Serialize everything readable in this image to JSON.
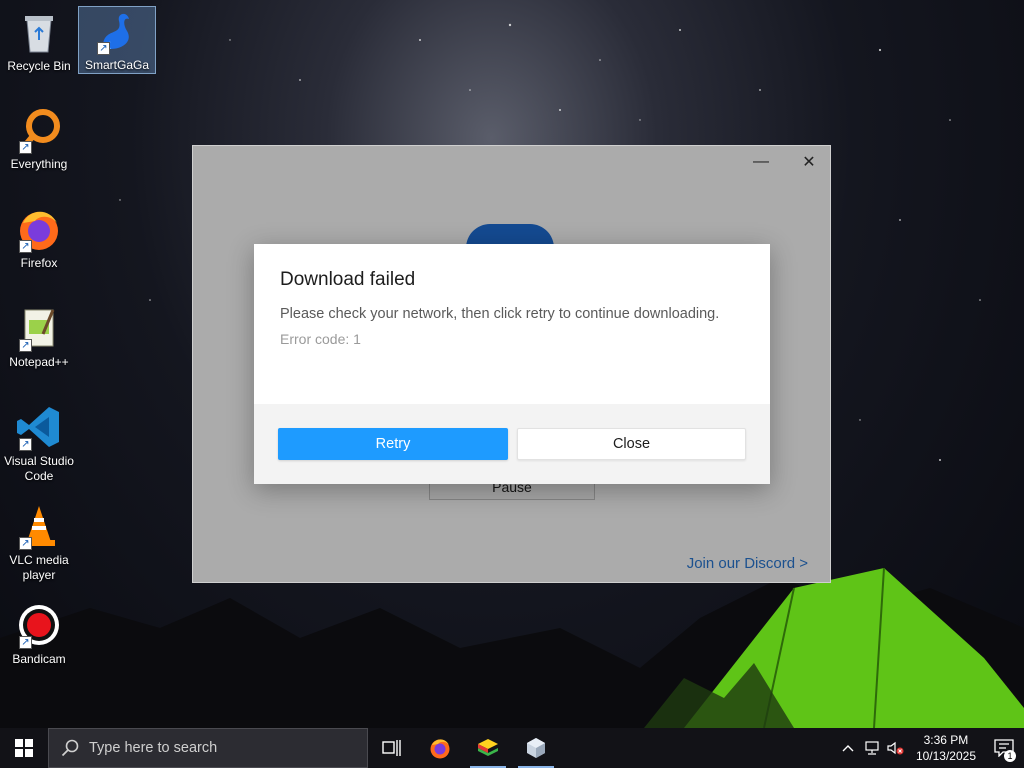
{
  "desktop": {
    "icons": [
      {
        "label": "Recycle Bin",
        "icon": "recycle-bin-icon"
      },
      {
        "label": "SmartGaGa",
        "icon": "smartgaga-icon"
      },
      {
        "label": "Everything",
        "icon": "everything-icon"
      },
      {
        "label": "Firefox",
        "icon": "firefox-icon"
      },
      {
        "label": "Notepad++",
        "icon": "notepad-plus-plus-icon"
      },
      {
        "label": "Visual Studio Code",
        "icon": "vscode-icon"
      },
      {
        "label": "VLC media player",
        "icon": "vlc-icon"
      },
      {
        "label": "Bandicam",
        "icon": "bandicam-icon"
      }
    ]
  },
  "app_window": {
    "minimize_glyph": "—",
    "close_glyph": "✕",
    "pause_label": "Pause",
    "discord_link": "Join our Discord >"
  },
  "dialog": {
    "title": "Download failed",
    "message": "Please check your network, then click retry to continue downloading.",
    "error_code": "Error code: 1",
    "retry_label": "Retry",
    "close_label": "Close"
  },
  "taskbar": {
    "search_placeholder": "Type here to search",
    "pinned": [
      {
        "name": "task-view",
        "icon": "task-view-icon"
      },
      {
        "name": "firefox",
        "icon": "firefox-icon"
      },
      {
        "name": "bluestacks",
        "icon": "bluestacks-icon"
      },
      {
        "name": "smartgaga-installer",
        "icon": "cube-icon"
      }
    ],
    "clock_time": "3:36 PM",
    "clock_date": "10/13/2025",
    "notification_count": "1"
  },
  "colors": {
    "accent": "#1e9bff",
    "link": "#2a7ad6",
    "taskbar": "#121217"
  }
}
